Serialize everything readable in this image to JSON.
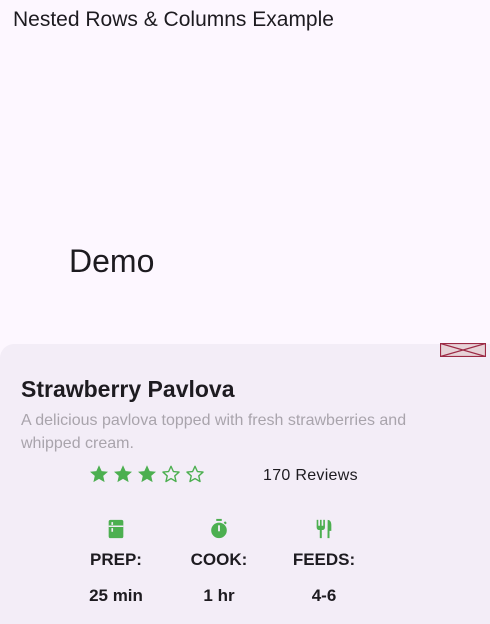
{
  "app_bar": {
    "title": "Nested Rows & Columns Example"
  },
  "main": {
    "heading": "Demo"
  },
  "recipe": {
    "title": "Strawberry Pavlova",
    "description": "A delicious pavlova topped with fresh strawberries and whipped cream.",
    "rating": {
      "filled": 3,
      "total": 5
    },
    "reviews": "170 Reviews",
    "stats": [
      {
        "icon": "kitchen-icon",
        "label": "PREP:",
        "value": "25 min"
      },
      {
        "icon": "timer-icon",
        "label": "COOK:",
        "value": "1 hr"
      },
      {
        "icon": "restaurant-icon",
        "label": "FEEDS:",
        "value": "4-6"
      }
    ]
  },
  "colors": {
    "accent_green": "#4CAF50",
    "background": "#FDF7FF",
    "card": "#F3EDF7",
    "muted_text": "#A9A4AC"
  }
}
